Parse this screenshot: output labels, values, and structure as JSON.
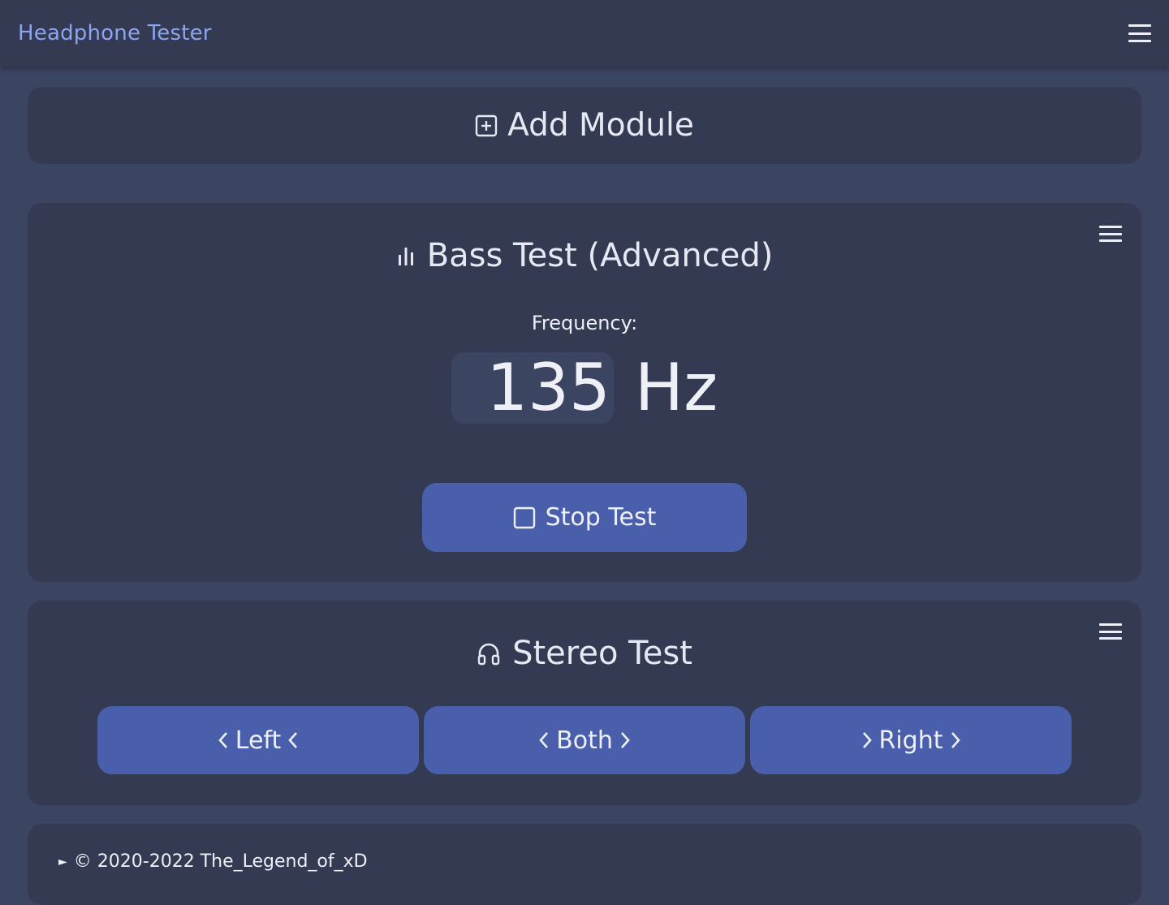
{
  "navbar": {
    "brand": "Headphone Tester"
  },
  "add_module": {
    "label": "Add Module"
  },
  "bass_test": {
    "title": "Bass Test (Advanced)",
    "frequency_label": "Frequency:",
    "frequency_value": "135",
    "frequency_unit": "Hz",
    "stop_label": "Stop Test"
  },
  "stereo_test": {
    "title": "Stereo Test",
    "buttons": {
      "left": "Left",
      "both": "Both",
      "right": "Right"
    }
  },
  "footer": {
    "text": "© 2020-2022 The_Legend_of_xD"
  },
  "colors": {
    "page_bg": "#3b4460",
    "card_bg": "#333a51",
    "button_bg": "#4a5fab",
    "brand": "#8ea4f2"
  },
  "icons": {
    "add": "plus-square-icon",
    "bass": "bar-chart-icon",
    "stop": "square-icon",
    "stereo": "headphones-icon",
    "chevron_left": "chevron-left-icon",
    "chevron_right": "chevron-right-icon",
    "menu": "hamburger-icon"
  }
}
